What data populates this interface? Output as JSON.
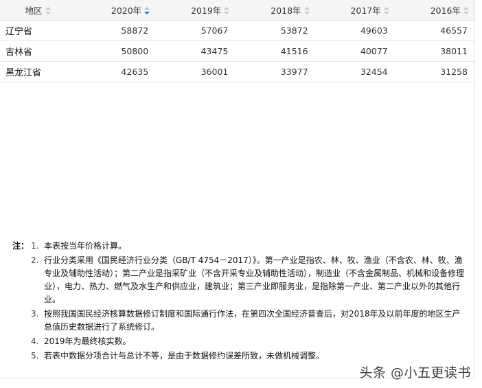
{
  "table": {
    "columns": [
      {
        "label": "地区",
        "sortable": true,
        "sort_state": "none"
      },
      {
        "label": "2020年",
        "sortable": true,
        "sort_state": "desc"
      },
      {
        "label": "2019年",
        "sortable": true,
        "sort_state": "none"
      },
      {
        "label": "2018年",
        "sortable": true,
        "sort_state": "none"
      },
      {
        "label": "2017年",
        "sortable": true,
        "sort_state": "none"
      },
      {
        "label": "2016年",
        "sortable": true,
        "sort_state": "none"
      }
    ],
    "rows": [
      {
        "region": "辽宁省",
        "values": [
          "58872",
          "57067",
          "53872",
          "49603",
          "46557"
        ]
      },
      {
        "region": "吉林省",
        "values": [
          "50800",
          "43475",
          "41516",
          "40077",
          "38011"
        ]
      },
      {
        "region": "黑龙江省",
        "values": [
          "42635",
          "36001",
          "33977",
          "32454",
          "31258"
        ]
      }
    ]
  },
  "notes": {
    "prefix": "注：",
    "items": [
      {
        "num": "1.",
        "text": "本表按当年价格计算。"
      },
      {
        "num": "2.",
        "text": "行业分类采用《国民经济行业分类（GB/T 4754－2017）》。第一产业是指农、林、牧、渔业（不含农、林、牧、渔专业及辅助性活动）；第二产业是指采矿业（不含开采专业及辅助性活动），制造业（不含金属制品、机械和设备修理业），电力、热力、燃气及水生产和供应业，建筑业；第三产业即服务业，是指除第一产业、第二产业以外的其他行业。"
      },
      {
        "num": "3.",
        "text": "按照我国国民经济核算数据修订制度和国际通行作法，在第四次全国经济普查后，对2018年及以前年度的地区生产总值历史数据进行了系统修订。"
      },
      {
        "num": "4.",
        "text": "2019年为最终核实数。"
      },
      {
        "num": "5.",
        "text": "若表中数据分项合计与总计不等，是由于数据修约误差所致，未做机械调整。"
      }
    ]
  },
  "watermark": "头条 @小五更读书"
}
